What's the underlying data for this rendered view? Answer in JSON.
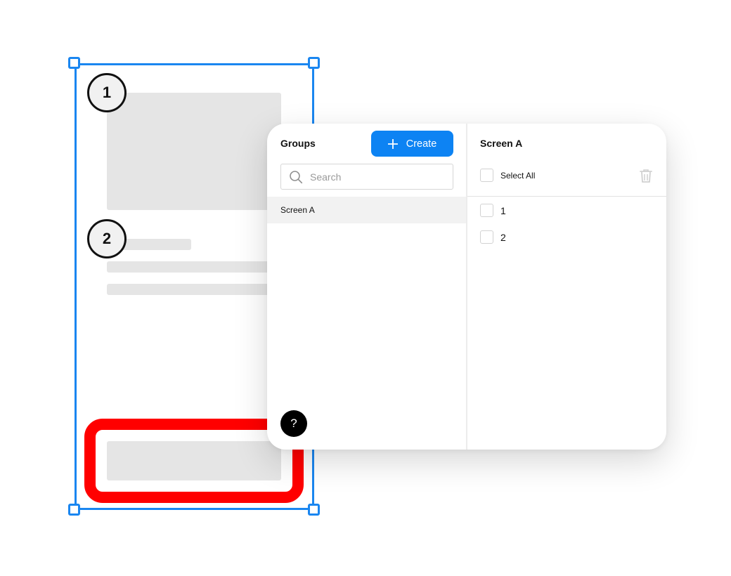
{
  "canvas": {
    "markers": [
      "1",
      "2"
    ],
    "accent_color": "#1a86f0",
    "highlight_color": "#ff0000"
  },
  "groups_panel": {
    "title": "Groups",
    "create_label": "Create",
    "search_placeholder": "Search",
    "groups": [
      "Screen A"
    ],
    "help_label": "?",
    "button_color": "#0d83f3"
  },
  "screen_panel": {
    "title": "Screen A",
    "select_all_label": "Select All",
    "items": [
      "1",
      "2"
    ]
  }
}
